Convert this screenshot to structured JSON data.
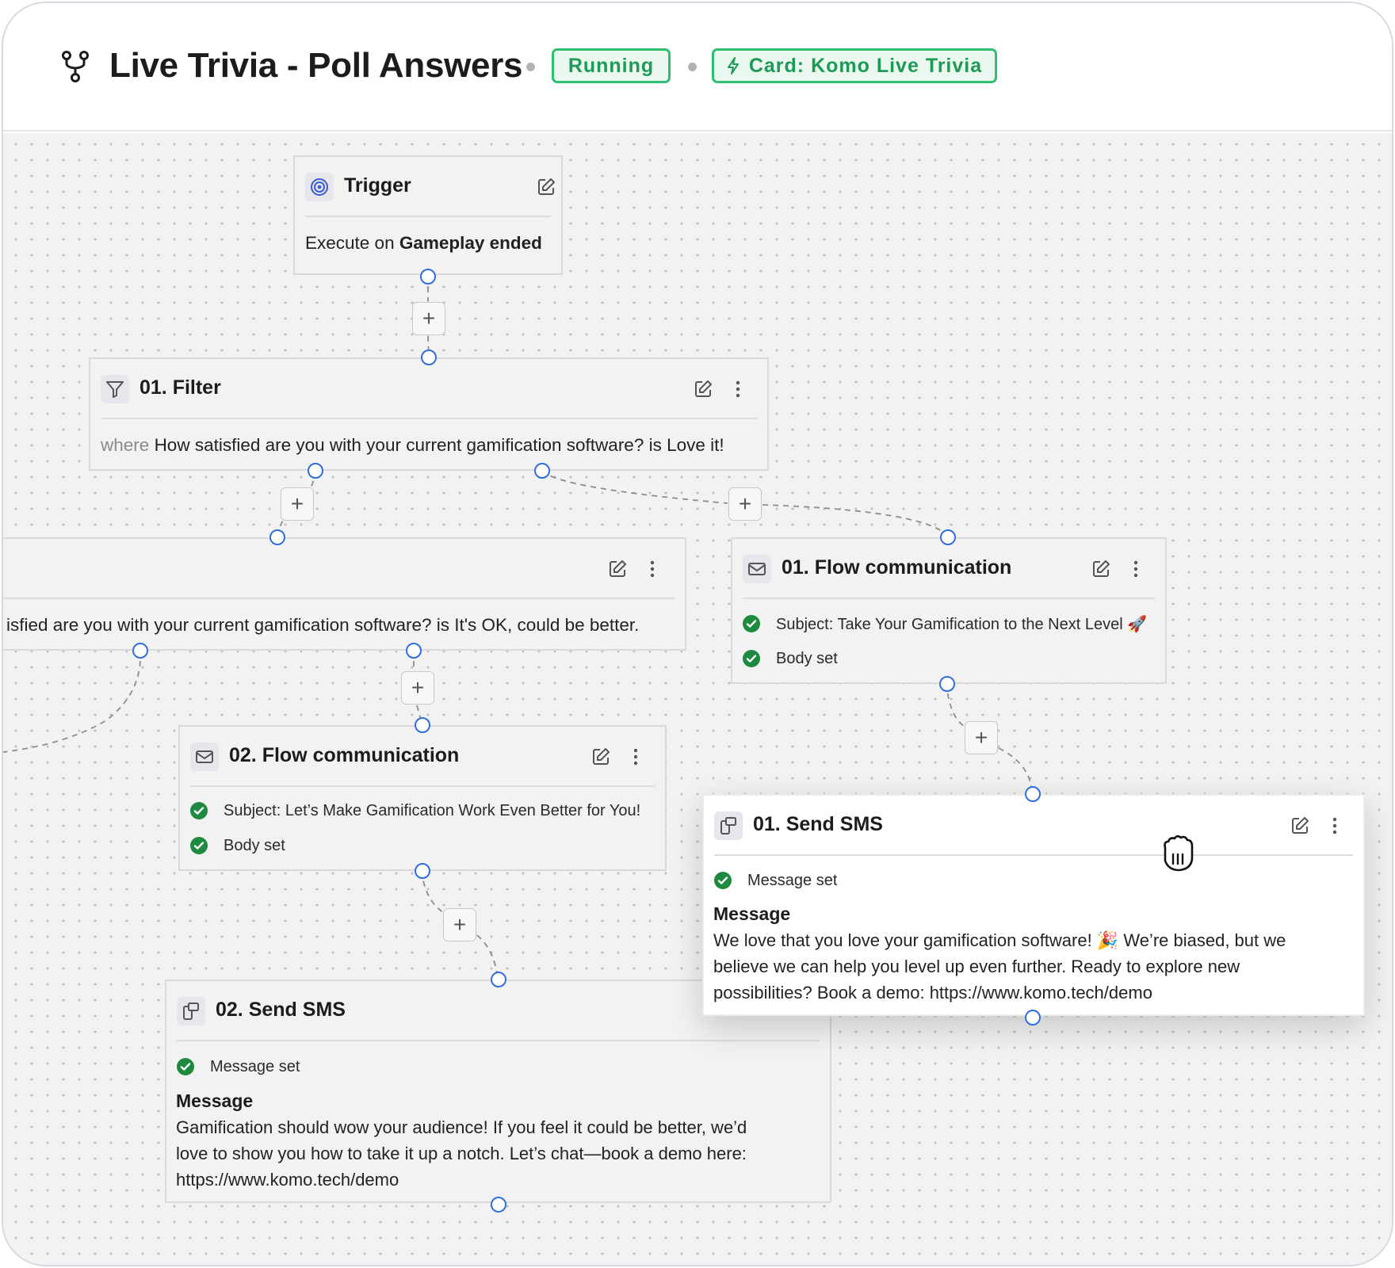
{
  "header": {
    "title": "Live Trivia - Poll Answers",
    "status_badge": "Running",
    "card_badge": "Card: Komo Live Trivia",
    "flow_icon": "flow-branch-icon",
    "bolt_icon": "lightning-icon"
  },
  "colors": {
    "accent_green": "#2fbf71",
    "handle_blue": "#2f6fdd",
    "check_green": "#1e8a3f"
  },
  "nodes": {
    "trigger": {
      "title": "Trigger",
      "icon": "target-icon",
      "prefix": "Execute on",
      "event": "Gameplay ended"
    },
    "filter_01": {
      "title": "01. Filter",
      "icon": "filter-icon",
      "where_label": "where",
      "condition": "How satisfied are you with your current gamification software? is Love it!"
    },
    "filter_02": {
      "condition": "isfied are you with your current gamification software? is It's OK, could be better."
    },
    "flow_comm_01": {
      "title": "01. Flow communication",
      "icon": "mail-icon",
      "subject": "Subject: Take Your Gamification to the Next Level 🚀",
      "body": "Body set"
    },
    "flow_comm_02": {
      "title": "02. Flow communication",
      "icon": "mail-icon",
      "subject": "Subject: Let’s Make Gamification Work Even Better for You!",
      "body": "Body set"
    },
    "sms_01": {
      "title": "01. Send SMS",
      "icon": "phone-message-icon",
      "status": "Message set",
      "message_label": "Message",
      "message_lines": [
        "We love that you love your gamification software! 🎉 We’re biased, but we",
        "believe we can help you level up even further. Ready to explore new",
        "possibilities? Book a demo: https://www.komo.tech/demo"
      ]
    },
    "sms_02": {
      "title": "02. Send SMS",
      "icon": "phone-message-icon",
      "status": "Message set",
      "message_label": "Message",
      "message_lines": [
        "Gamification should wow your audience! If you feel it could be better, we’d",
        "love to show you how to take it up a notch. Let’s chat—book a demo here:",
        "https://www.komo.tech/demo"
      ]
    }
  },
  "add_button_label": "+"
}
